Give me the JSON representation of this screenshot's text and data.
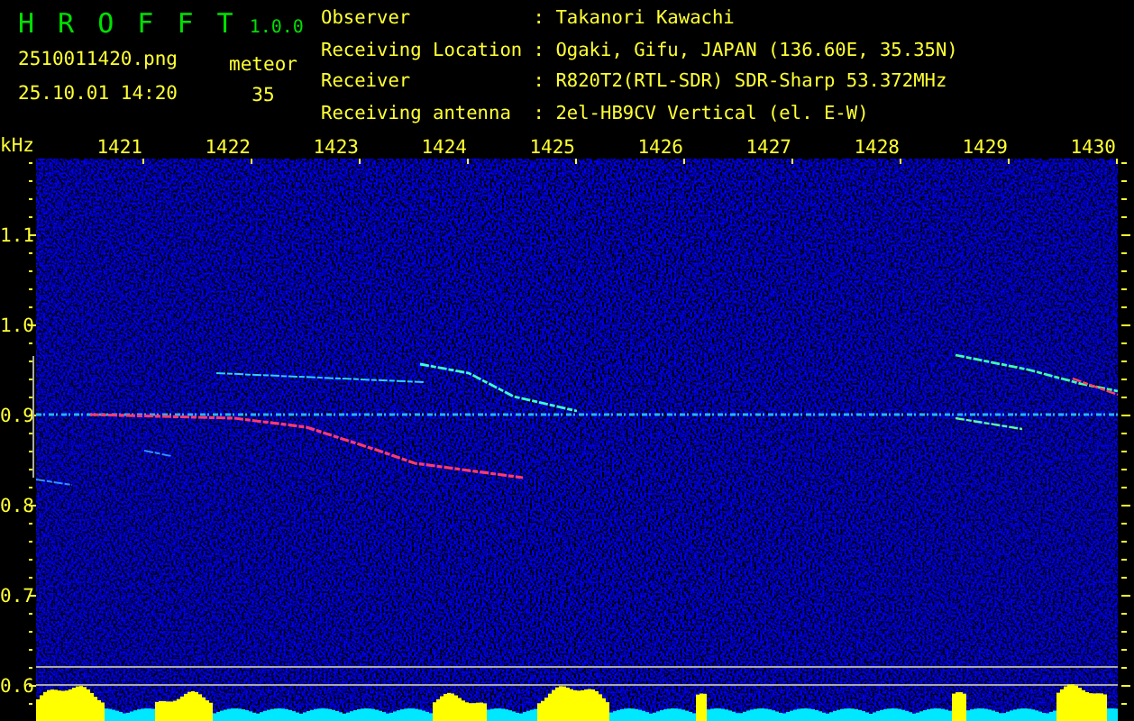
{
  "app": {
    "title": "H R O F F T",
    "version": "1.0.0"
  },
  "file": {
    "name": "2510011420.png",
    "datetime": "25.10.01 14:20"
  },
  "counter": {
    "label": "meteor",
    "value": "35"
  },
  "info": [
    {
      "label": "Observer",
      "value": ": Takanori Kawachi"
    },
    {
      "label": "Receiving Location",
      "value": ": Ogaki, Gifu, JAPAN (136.60E, 35.35N)"
    },
    {
      "label": "Receiver",
      "value": ": R820T2(RTL-SDR) SDR-Sharp 53.372MHz"
    },
    {
      "label": "Receiving antenna",
      "value": ": 2el-HB9CV Vertical (el. E-W)"
    }
  ],
  "spectrogram": {
    "y_unit": "kHz",
    "x_labels": [
      "1421",
      "1422",
      "1423",
      "1424",
      "1425",
      "1426",
      "1427",
      "1428",
      "1429",
      "1430"
    ],
    "y_labels": [
      "1.1",
      "1.0",
      "0.9",
      "0.8",
      "0.7",
      "0.6"
    ]
  }
}
